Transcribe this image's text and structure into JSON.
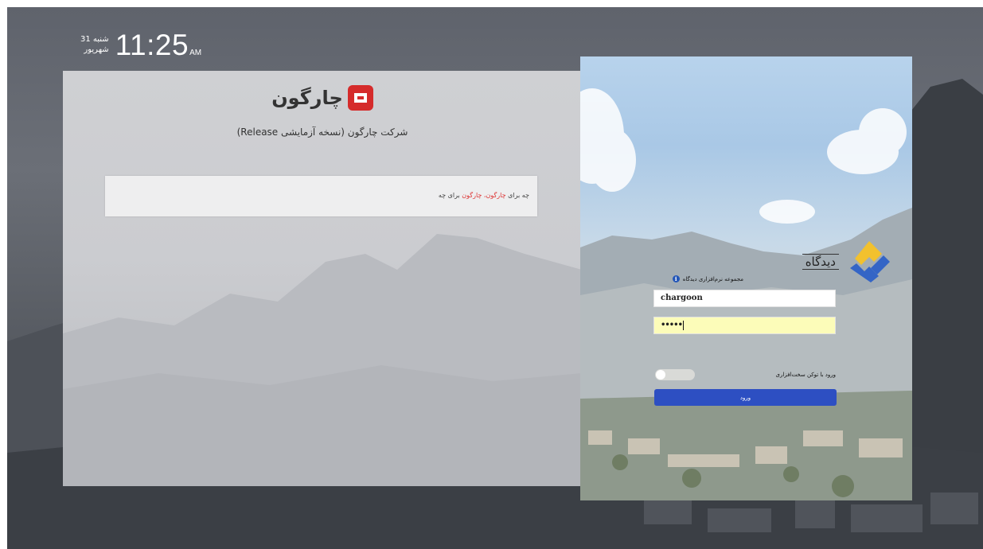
{
  "clock": {
    "day_name": "شنبه 31",
    "month": "شهریور",
    "time": "11:25",
    "ampm": "AM"
  },
  "left_panel": {
    "logo_text": "چارگون",
    "company_name": "شرکت چارگون (نسخه آزمایشی Release)",
    "notice": {
      "before": "چه برای",
      "highlight": "چارگون، چارگون",
      "after": "برای چه"
    }
  },
  "login": {
    "brand_wordmark": "دیدگاه",
    "field_label": "مجموعه نرم‌افزاری دیدگاه",
    "username_value": "chargoon",
    "password_value": "•••••",
    "toggle_label": "ورود با توکن سخت‌افزاری",
    "submit_label": "ورود"
  },
  "colors": {
    "accent_blue": "#2d4fc2",
    "logo_red": "#d52b2b",
    "password_bg": "#fcfcb9",
    "brand_yellow": "#f2c12e",
    "brand_blue": "#3465c6"
  },
  "icons": {
    "info": "info-icon",
    "brand_logo": "didgah-logo-icon",
    "company_logo": "chargoon-logo-icon"
  }
}
